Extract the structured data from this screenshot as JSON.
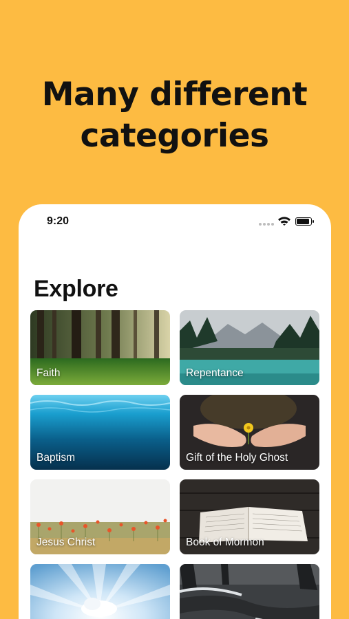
{
  "headline": {
    "line1": "Many different",
    "line2": "categories"
  },
  "status_bar": {
    "time": "9:20"
  },
  "page": {
    "title": "Explore"
  },
  "categories": [
    {
      "label": "Faith"
    },
    {
      "label": "Repentance"
    },
    {
      "label": "Baptism"
    },
    {
      "label": "Gift of the Holy Ghost"
    },
    {
      "label": "Jesus Christ"
    },
    {
      "label": "Book of Mormon"
    },
    {
      "label": ""
    },
    {
      "label": ""
    }
  ],
  "colors": {
    "background": "#FDBB42",
    "card_text": "#FFFFFF"
  }
}
